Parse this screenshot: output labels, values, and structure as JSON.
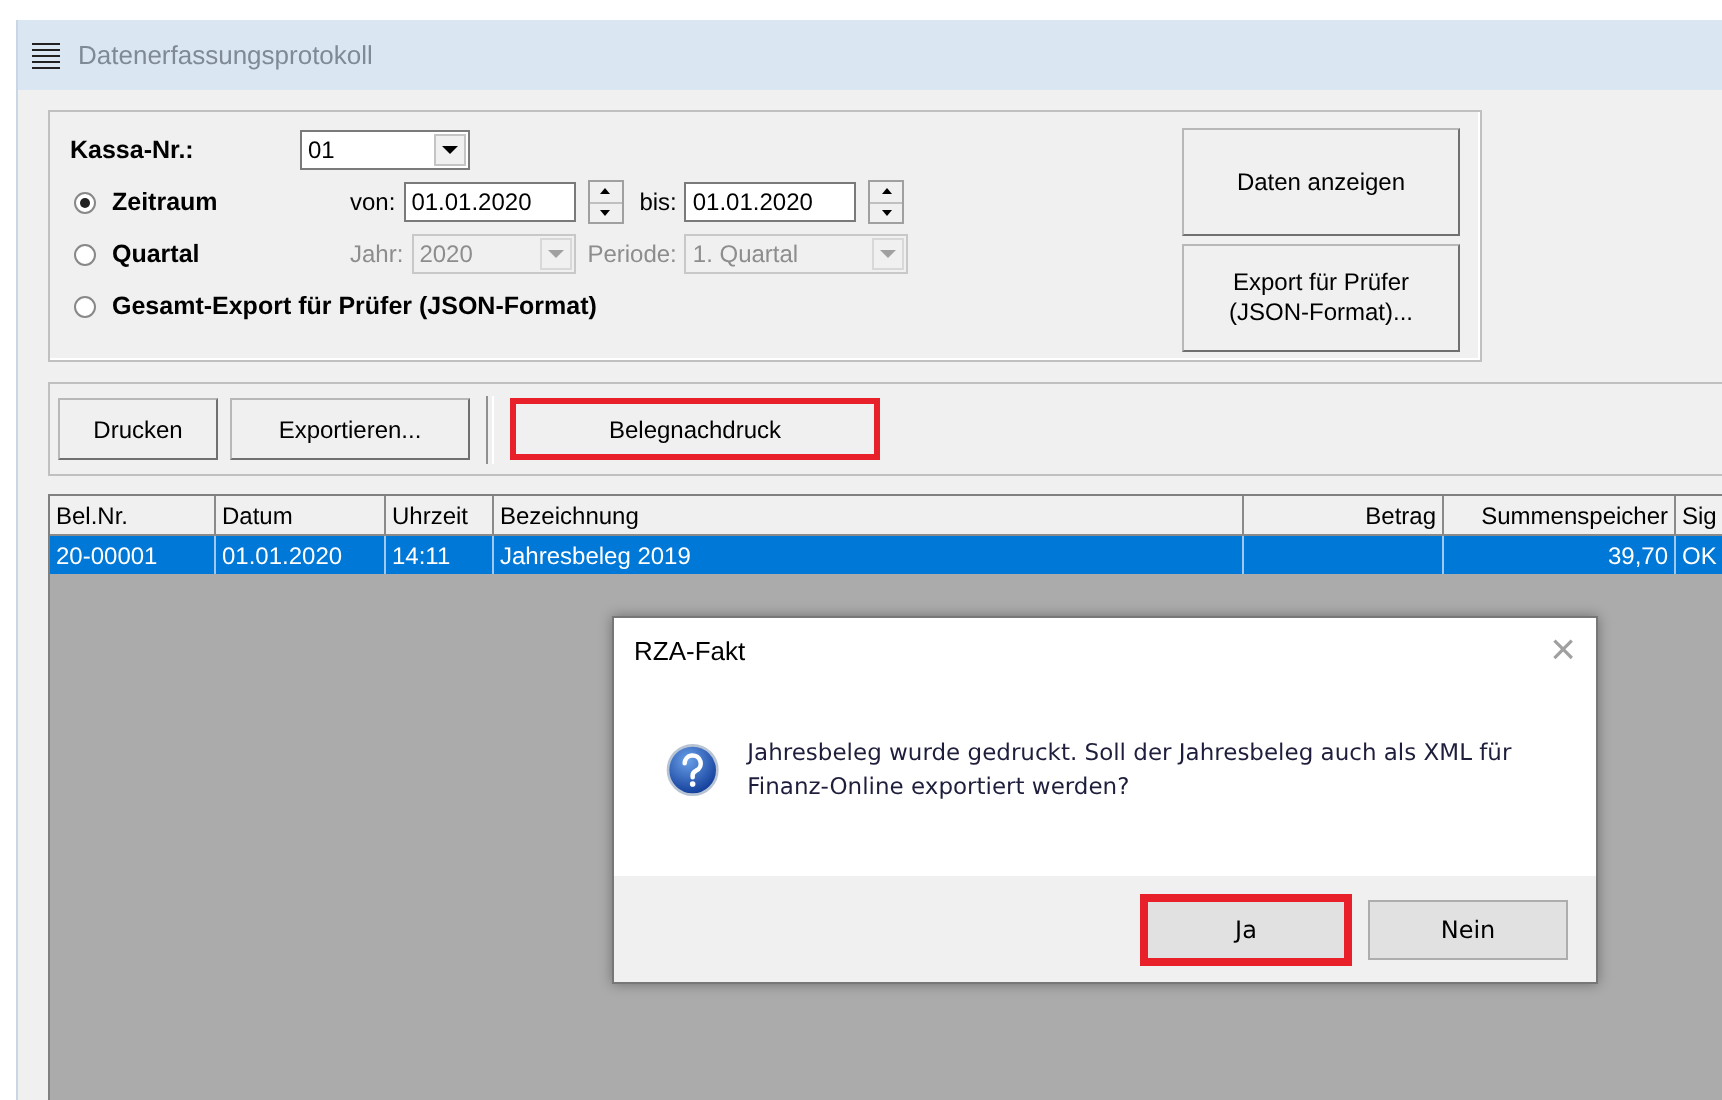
{
  "window": {
    "title": "Datenerfassungsprotokoll"
  },
  "filter": {
    "kassa_label": "Kassa-Nr.:",
    "kassa_value": "01",
    "options": [
      {
        "kind": "range",
        "label": "Zeitraum",
        "selected": true,
        "disabled": false,
        "field1_label": "von:",
        "field1_value": "01.01.2020",
        "field2_label": "bis:",
        "field2_value": "01.01.2020"
      },
      {
        "kind": "quarter",
        "label": "Quartal",
        "selected": false,
        "disabled": true,
        "field1_label": "Jahr:",
        "field1_value": "2020",
        "field2_label": "Periode:",
        "field2_value": "1. Quartal"
      },
      {
        "kind": "plain",
        "label": "Gesamt-Export für Prüfer (JSON-Format)",
        "selected": false
      }
    ]
  },
  "side_buttons": [
    {
      "label": "Daten anzeigen"
    },
    {
      "label": "Export für Prüfer\n(JSON-Format)..."
    }
  ],
  "toolbar": [
    {
      "label": "Drucken",
      "highlighted": false,
      "separator_before": false
    },
    {
      "label": "Exportieren...",
      "highlighted": false,
      "separator_before": false
    },
    {
      "label": "Belegnachdruck",
      "highlighted": true,
      "separator_before": true
    }
  ],
  "table": {
    "columns": [
      {
        "label": "Bel.Nr."
      },
      {
        "label": "Datum"
      },
      {
        "label": "Uhrzeit"
      },
      {
        "label": "Bezeichnung"
      },
      {
        "label": "Betrag"
      },
      {
        "label": "Summenspeicher"
      },
      {
        "label": "Sig"
      }
    ],
    "rows": [
      {
        "selected": true,
        "cells": [
          "20-00001",
          "01.01.2020",
          "14:11",
          "Jahresbeleg 2019",
          "",
          "39,70",
          "OK"
        ]
      }
    ]
  },
  "dialog": {
    "title": "RZA-Fakt",
    "close": "×",
    "message": "Jahresbeleg wurde gedruckt. Soll der Jahresbeleg auch als XML für Finanz-Online exportiert werden?",
    "buttons": [
      {
        "label": "Ja",
        "highlighted": true
      },
      {
        "label": "Nein",
        "highlighted": false
      }
    ]
  }
}
